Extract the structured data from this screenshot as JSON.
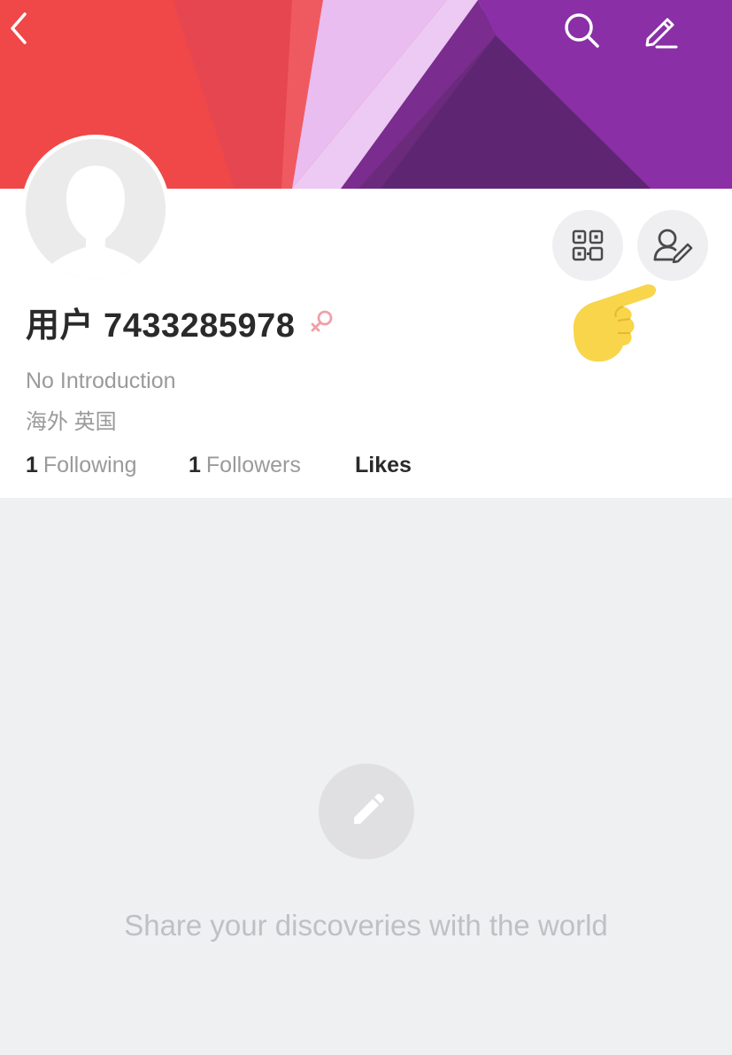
{
  "header": {
    "back_icon": "chevron-left-icon",
    "search_icon": "search-icon",
    "compose_icon": "pencil-icon"
  },
  "profile": {
    "username": "用户 7433285978",
    "gender_icon": "female-icon",
    "introduction": "No Introduction",
    "location": "海外 英国",
    "qr_icon": "qr-code-icon",
    "edit_icon": "user-edit-icon",
    "pointer_emoji": "pointing-hand-emoji"
  },
  "stats": {
    "following_count": "1",
    "following_label": "Following",
    "followers_count": "1",
    "followers_label": "Followers",
    "likes_label": "Likes"
  },
  "empty_state": {
    "icon": "pencil-icon",
    "message": "Share your discoveries with the world"
  },
  "colors": {
    "banner_red": "#f04a4a",
    "banner_pink": "#e8bdf0",
    "banner_purple": "#8c2fa8",
    "gender_pink": "#f0a0a8",
    "hand_yellow": "#f9d84a"
  }
}
